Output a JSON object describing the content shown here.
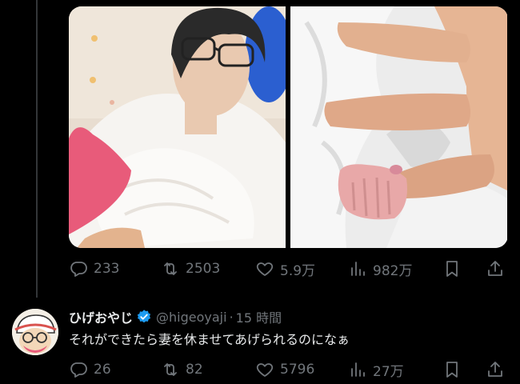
{
  "post": {
    "stats": {
      "replies": "233",
      "reposts": "2503",
      "likes": "5.9万",
      "views": "982万"
    }
  },
  "reply": {
    "display_name": "ひげおやじ",
    "handle": "@higeoyaji",
    "separator": "·",
    "time": "15 時間",
    "text": "それができたら妻を休ませてあげられるのになぁ",
    "stats": {
      "replies": "26",
      "reposts": "82",
      "likes": "5796",
      "views": "27万"
    }
  },
  "colors": {
    "background": "#000000",
    "text": "#e7e9ea",
    "muted": "#71767b",
    "verified": "#1d9bf0",
    "heart_sticker": "#e85b7a"
  },
  "icons": [
    "reply-icon",
    "repost-icon",
    "like-icon",
    "views-icon",
    "bookmark-icon",
    "share-icon",
    "verified-badge-icon"
  ]
}
